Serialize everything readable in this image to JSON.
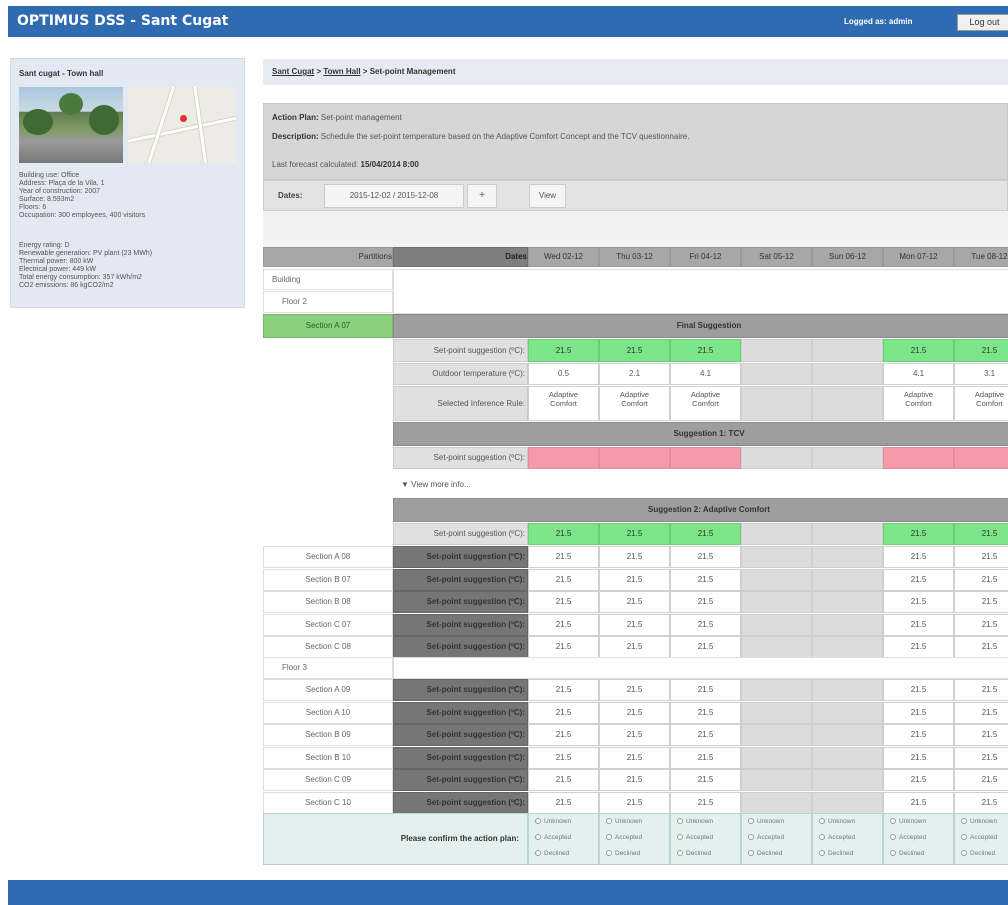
{
  "header": {
    "title": "OPTIMUS DSS - Sant Cugat",
    "logged_as": "Logged as: admin",
    "logout_label": "Log out"
  },
  "sidebar": {
    "title": "Sant cugat - Town hall",
    "details": [
      "Building use: Office",
      "Address: Plaça de la Vila, 1",
      "Year of construction: 2007",
      "Surface: 8.593m2",
      "Floors: 6",
      "Occupation: 300 employees, 400 visitors"
    ],
    "energy": [
      "Energy rating: D",
      "Renewable generation: PV plant (23 MWh)",
      "Thermal power: 800 kW",
      "Electrical power: 449 kW",
      "Total energy consumption: 357 kWh/m2",
      "CO2 emissions: 86 kgCO2/m2"
    ]
  },
  "breadcrumb": {
    "item1": "Sant Cugat",
    "sep": ">",
    "item2": "Town Hall",
    "current": "Set-point Management"
  },
  "plan": {
    "action_label": "Action Plan:",
    "action_value": "Set-point management",
    "desc_label": "Description:",
    "desc_value": "Schedule the set-point temperature based on the Adaptive Comfort Concept and the TCV questionnaire.",
    "forecast_label": "Last forecast calculated:",
    "forecast_value": "15/04/2014 8:00"
  },
  "dates": {
    "label": "Dates:",
    "value": "2015-12-02 / 2015-12-08",
    "plus": "+",
    "view": "View"
  },
  "grid": {
    "col_partitions": "Partitions",
    "col_dates": "Dates",
    "days": [
      "Wed 02-12",
      "Thu 03-12",
      "Fri 04-12",
      "Sat 05-12",
      "Sun 06-12",
      "Mon 07-12",
      "Tue 08-12"
    ],
    "building": "Building",
    "floor2": "Floor 2",
    "floor3": "Floor 3",
    "selected_section": "Section A 07",
    "final_title": "Final Suggestion",
    "row_setpoint": "Set-point suggestion (ºC):",
    "row_outdoor": "Outdoor temperature (ºC):",
    "row_rule": "Selected Inference Rule:",
    "setpoints": [
      "21.5",
      "21.5",
      "21.5",
      "",
      "",
      "21.5",
      "21.5"
    ],
    "outdoor": [
      "0.5",
      "2.1",
      "4.1",
      "",
      "",
      "4.1",
      "3.1"
    ],
    "rule_line1": "Adaptive",
    "rule_line2": "Comfort",
    "rule_days": [
      true,
      true,
      true,
      false,
      false,
      true,
      true
    ],
    "tcv_title": "Suggestion 1: TCV",
    "more_info": "▼ View more info...",
    "ac_title": "Suggestion 2: Adaptive Comfort",
    "sections_f2": [
      "Section A 08",
      "Section B 07",
      "Section B 08",
      "Section C 07",
      "Section C 08"
    ],
    "sections_f3": [
      "Section A 09",
      "Section A 10",
      "Section B 09",
      "Section B 10",
      "Section C 09",
      "Section C 10"
    ],
    "confirm": "Please confirm the action plan:",
    "opt_unknown": "Unknown",
    "opt_accepted": "Accepted",
    "opt_declined": "Declined"
  },
  "colors": {
    "brand": "#2e6bb0",
    "suggest_green": "#7ce58a",
    "tcv_pink": "#f59aab",
    "selected": "#8bcf7f"
  }
}
